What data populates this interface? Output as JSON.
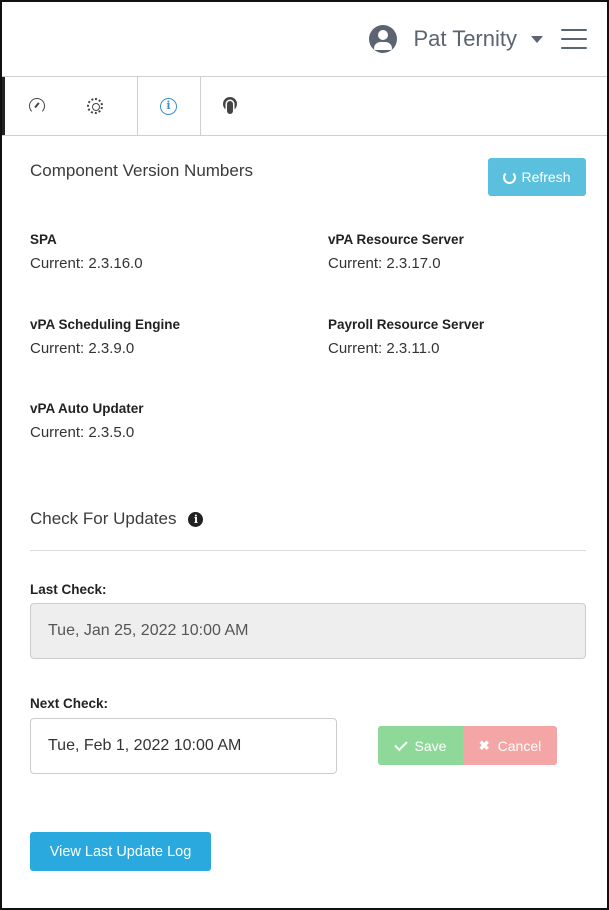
{
  "header": {
    "user_name": "Pat Ternity",
    "user_icon": "user-circle-icon",
    "menu_icon": "hamburger-menu-icon"
  },
  "tabs": [
    {
      "icon": "gauge-icon",
      "active": false
    },
    {
      "icon": "gear-icon",
      "active": false
    },
    {
      "icon": "info-circle-icon",
      "active": true
    },
    {
      "icon": "podcast-icon",
      "active": false
    }
  ],
  "versions": {
    "title": "Component Version Numbers",
    "refresh_label": "Refresh",
    "components": [
      {
        "name": "SPA",
        "version": "Current: 2.3.16.0"
      },
      {
        "name": "vPA Resource Server",
        "version": "Current: 2.3.17.0"
      },
      {
        "name": "vPA Scheduling Engine",
        "version": "Current: 2.3.9.0"
      },
      {
        "name": "Payroll Resource Server",
        "version": "Current: 2.3.11.0"
      },
      {
        "name": "vPA Auto Updater",
        "version": "Current: 2.3.5.0"
      }
    ]
  },
  "updates": {
    "title": "Check For Updates",
    "last_check_label": "Last Check:",
    "last_check_value": "Tue, Jan 25, 2022 10:00 AM",
    "next_check_label": "Next Check:",
    "next_check_value": "Tue, Feb 1, 2022 10:00 AM",
    "save_label": "Save",
    "cancel_label": "Cancel",
    "view_log_label": "View Last Update Log"
  },
  "colors": {
    "info_button": "#5bc0de",
    "primary_button": "#29a9de",
    "success_button": "#8ed99a",
    "danger_button": "#f4a6a6",
    "active_tab_icon": "#3a8fd6"
  }
}
